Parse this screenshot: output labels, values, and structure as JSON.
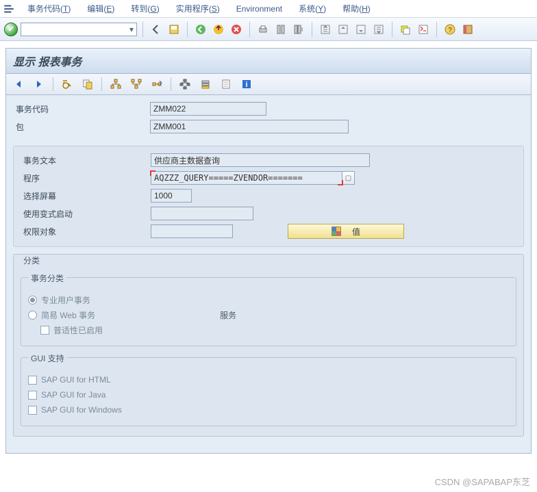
{
  "menu": {
    "items": [
      {
        "label": "事务代码(T)",
        "u": "T"
      },
      {
        "label": "编辑(E)",
        "u": "E"
      },
      {
        "label": "转到(G)",
        "u": "G"
      },
      {
        "label": "实用程序(S)",
        "u": "S"
      },
      {
        "label": "Environment",
        "u": ""
      },
      {
        "label": "系统(Y)",
        "u": "Y"
      },
      {
        "label": "帮助(H)",
        "u": "H"
      }
    ]
  },
  "title": "显示 报表事务",
  "fields": {
    "tcode_label": "事务代码",
    "tcode_value": "ZMM022",
    "package_label": "包",
    "package_value": "ZMM001",
    "text_label": "事务文本",
    "text_value": "供应商主数据查询",
    "program_label": "程序",
    "program_value": "AQZZZ_QUERY=====ZVENDOR=======",
    "screen_label": "选择屏幕",
    "screen_value": "1000",
    "variant_label": "使用变式启动",
    "variant_value": "",
    "authobj_label": "权限对象",
    "authobj_value": "",
    "value_btn_label": "值"
  },
  "classification": {
    "group_title": "分类",
    "tx_class_title": "事务分类",
    "radio_professional": "专业用户事务",
    "radio_easyweb": "简易 Web 事务",
    "service_label": "服务",
    "check_universal": "普适性已启用",
    "gui_title": "GUI 支持",
    "gui_html": "SAP GUI for HTML",
    "gui_java": "SAP GUI for Java",
    "gui_windows": "SAP GUI for Windows"
  },
  "watermark": "CSDN @SAPABAP东芝"
}
